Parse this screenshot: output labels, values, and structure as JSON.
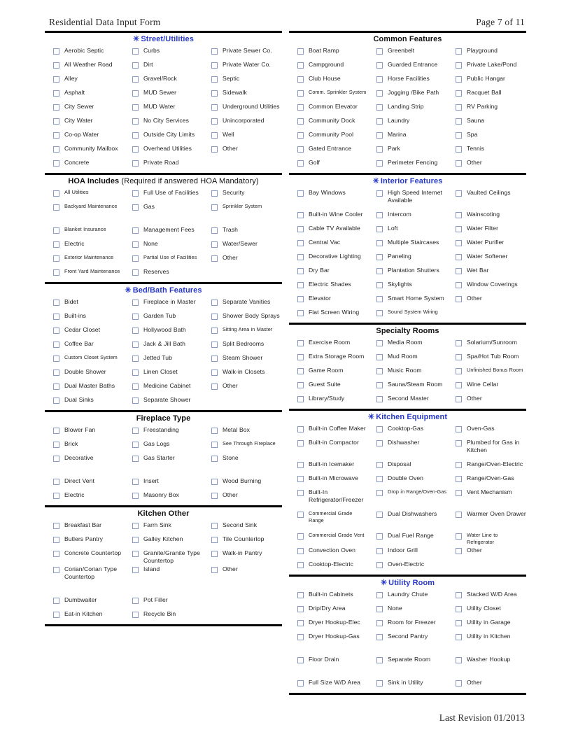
{
  "header": {
    "title": "Residential Data Input Form",
    "page_label": "Page 7 of 11"
  },
  "footer": {
    "revision": "Last Revision 01/2013"
  },
  "colors": {
    "accent_blue": "#2738c8",
    "checkbox_border": "#8a99c4",
    "rule": "#000000"
  },
  "icons": {
    "asterisk": "✳"
  },
  "sections": {
    "street_utilities": {
      "title": "Street/Utilities",
      "starred": true,
      "blue": true,
      "items": [
        "Aerobic Septic",
        "Curbs",
        "Private Sewer Co.",
        "All Weather Road",
        "Dirt",
        "Private Water Co.",
        "Alley",
        "Gravel/Rock",
        "Septic",
        "Asphalt",
        "MUD Sewer",
        "Sidewalk",
        "City Sewer",
        "MUD Water",
        "Underground Utilities",
        "City Water",
        "No City Services",
        "Unincorporated",
        "Co-op Water",
        "Outside City Limits",
        "Well",
        "Community Mailbox",
        "Overhead Utilities",
        "Other",
        "Concrete",
        "Private Road",
        ""
      ]
    },
    "hoa_includes": {
      "title": "HOA Includes",
      "subtitle": "(Required if answered HOA Mandatory)",
      "starred": false,
      "blue": false,
      "items": [
        "All Utilities",
        "Full Use of Facilities",
        "Security",
        "Backyard Maintenance",
        "Gas",
        "Sprinkler System",
        "Blanket Insurance",
        "Management Fees",
        "Trash",
        "Electric",
        "None",
        "Water/Sewer",
        "Exterior Maintenance",
        "Partial Use of Facilities",
        "Other",
        "Front Yard Maintenance",
        "Reserves",
        ""
      ],
      "gap_after_row": 1,
      "small_items": [
        "Backyard Maintenance",
        "Blanket Insurance",
        "Exterior Maintenance",
        "Front Yard Maintenance",
        "Partial Use of Facilities",
        "Sprinkler System",
        "All Utilities"
      ]
    },
    "bed_bath_features": {
      "title": "Bed/Bath Features",
      "starred": true,
      "blue": true,
      "items": [
        "Bidet",
        "Fireplace in Master",
        "Separate Vanities",
        "Built-ins",
        "Garden Tub",
        "Shower Body Sprays",
        "Cedar Closet",
        "Hollywood Bath",
        "Sitting Area in Master",
        "Coffee Bar",
        "Jack & Jill Bath",
        "Split Bedrooms",
        "Custom Closet System",
        "Jetted Tub",
        "Steam Shower",
        "Double Shower",
        "Linen Closet",
        "Walk-in Closets",
        "Dual Master Baths",
        "Medicine Cabinet",
        "Other",
        "Dual Sinks",
        "Separate Shower",
        ""
      ],
      "small_items": [
        "Custom Closet System",
        "Sitting Area in Master"
      ]
    },
    "fireplace_type": {
      "title": "Fireplace Type",
      "starred": false,
      "blue": false,
      "items": [
        "Blower Fan",
        "Freestanding",
        "Metal Box",
        "Brick",
        "Gas Logs",
        "See Through Fireplace",
        "Decorative",
        "Gas Starter",
        "Stone",
        "Direct Vent",
        "Insert",
        "Wood Burning",
        "Electric",
        "Masonry Box",
        "Other"
      ],
      "gap_after_row": 2,
      "small_items": [
        "See Through Fireplace"
      ]
    },
    "kitchen_other": {
      "title": "Kitchen Other",
      "starred": false,
      "blue": false,
      "items": [
        "Breakfast Bar",
        "Farm Sink",
        "Second Sink",
        "Butlers Pantry",
        "Galley Kitchen",
        "Tile Countertop",
        "Concrete Countertop",
        "Granite/Granite Type Countertop",
        "Walk-in Pantry",
        "Corian/Corian Type Countertop",
        "Island",
        "Other",
        "Dumbwaiter",
        "Pot Filler",
        "",
        "Eat-in Kitchen",
        "Recycle Bin",
        ""
      ],
      "gap_after_row": 3,
      "tall_rows": [
        3
      ]
    },
    "common_features": {
      "title": "Common Features",
      "starred": false,
      "blue": false,
      "items": [
        "Boat Ramp",
        "Greenbelt",
        "Playground",
        "Campground",
        "Guarded Entrance",
        "Private Lake/Pond",
        "Club House",
        "Horse Facilities",
        "Public Hangar",
        "Comm. Sprinkler System",
        "Jogging /Bike Path",
        "Racquet Ball",
        "Common Elevator",
        "Landing Strip",
        "RV Parking",
        "Community Dock",
        "Laundry",
        "Sauna",
        "Community Pool",
        "Marina",
        "Spa",
        "Gated Entrance",
        "Park",
        "Tennis",
        "Golf",
        "Perimeter Fencing",
        "Other"
      ],
      "small_items": [
        "Comm. Sprinkler System"
      ]
    },
    "interior_features": {
      "title": "Interior Features",
      "starred": true,
      "blue": true,
      "items": [
        "Bay Windows",
        "High Speed Internet Available",
        "Vaulted Ceilings",
        "Built-in Wine Cooler",
        "Intercom",
        "Wainscoting",
        "Cable TV Available",
        "Loft",
        "Water Filter",
        "Central Vac",
        "Multiple Staircases",
        "Water Purifier",
        "Decorative Lighting",
        "Paneling",
        "Water Softener",
        "Dry Bar",
        "Plantation Shutters",
        "Wet Bar",
        "Electric Shades",
        "Skylights",
        "Window Coverings",
        "Elevator",
        "Smart Home System",
        "Other",
        "Flat Screen Wiring",
        "Sound System Wiring",
        ""
      ],
      "small_items": [
        "Sound System Wiring"
      ],
      "tall_rows": [
        0
      ]
    },
    "specialty_rooms": {
      "title": "Specialty Rooms",
      "starred": false,
      "blue": false,
      "items": [
        "Exercise Room",
        "Media Room",
        "Solarium/Sunroom",
        "Extra Storage Room",
        "Mud Room",
        "Spa/Hot Tub Room",
        "Game Room",
        "Music Room",
        "Unfinished Bonus Room",
        "Guest Suite",
        "Sauna/Steam Room",
        "Wine Cellar",
        "Library/Study",
        "Second Master",
        "Other"
      ],
      "small_items": [
        "Unfinished Bonus Room"
      ]
    },
    "kitchen_equipment": {
      "title": "Kitchen Equipment",
      "starred": true,
      "blue": true,
      "items": [
        "Built-in Coffee Maker",
        "Cooktop-Gas",
        "Oven-Gas",
        "Built-in Compactor",
        "Dishwasher",
        "Plumbed for Gas in Kitchen",
        "Built-in Icemaker",
        "Disposal",
        "Range/Oven-Electric",
        "Built-in Microwave",
        "Double Oven",
        "Range/Oven-Gas",
        "Built-In Refrigerator/Freezer",
        "Drop in Range/Oven-Gas",
        "Vent Mechanism",
        "Commercial Grade Range",
        "Dual Dishwashers",
        "Warmer Oven Drawer",
        "Commercial Grade Vent",
        "Dual Fuel Range",
        "Water Line to Refrigerator",
        "Convection Oven",
        "Indoor Grill",
        "Other",
        "Cooktop-Electric",
        "Oven-Electric",
        ""
      ],
      "small_items": [
        "Commercial Grade Range",
        "Commercial Grade Vent",
        "Water Line to Refrigerator",
        "Drop in Range/Oven-Gas"
      ],
      "tall_rows": [
        1,
        4,
        5
      ]
    },
    "utility_room": {
      "title": "Utility Room",
      "starred": true,
      "blue": true,
      "items": [
        "Built-in Cabinets",
        "Laundry Chute",
        "Stacked W/D Area",
        "Drip/Dry Area",
        "None",
        "Utility Closet",
        "Dryer Hookup-Elec",
        "Room for Freezer",
        "Utility in Garage",
        "Dryer Hookup-Gas",
        "Second Pantry",
        "Utility in Kitchen",
        "Floor Drain",
        "Separate Room",
        "Washer Hookup",
        "Full Size W/D Area",
        "Sink in Utility",
        "Other"
      ],
      "gap_rows": [
        3,
        4
      ]
    }
  },
  "layout": {
    "left_order": [
      "street_utilities",
      "hoa_includes",
      "bed_bath_features",
      "fireplace_type",
      "kitchen_other"
    ],
    "right_order": [
      "common_features",
      "interior_features",
      "specialty_rooms",
      "kitchen_equipment",
      "utility_room"
    ]
  }
}
